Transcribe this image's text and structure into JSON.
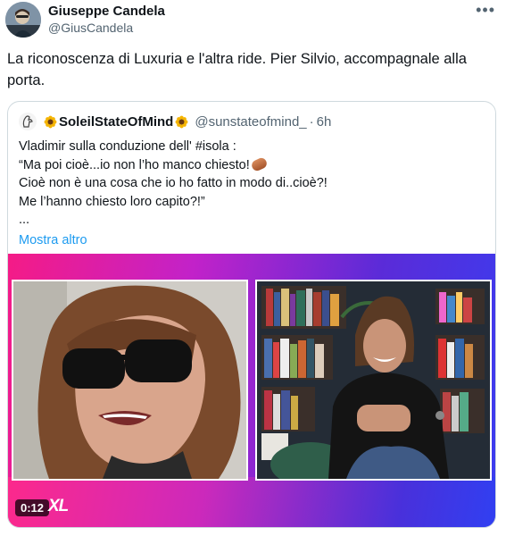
{
  "author": {
    "display_name": "Giuseppe Candela",
    "handle": "@GiusCandela"
  },
  "more_icon": "more-horizontal-icon",
  "tweet_text": "La riconoscenza di Luxuria e l'altra ride. Pier Silvio, accompagnale alla porta.",
  "quoted": {
    "name": "SoleilStateOfMind",
    "handle": "@sunstateofmind_",
    "separator": "·",
    "time": "6h",
    "lines": [
      "Vladimir sulla conduzione dell' #isola :",
      "“Ma poi cioè...io non l’ho manco chiesto!",
      "Cioè non è una cosa che io ho fatto in modo di..cioè?!",
      "Me l’hanno chiesto loro capito?!”",
      "..."
    ],
    "show_more": "Mostra altro"
  },
  "video": {
    "duration": "0:12",
    "logo_text": "XL"
  },
  "colors": {
    "text": "#0f1419",
    "secondary": "#536471",
    "link": "#1d9bf0",
    "border": "#cfd9de",
    "gradient_pink": "#f51b86",
    "gradient_blue": "#3a3df0"
  }
}
